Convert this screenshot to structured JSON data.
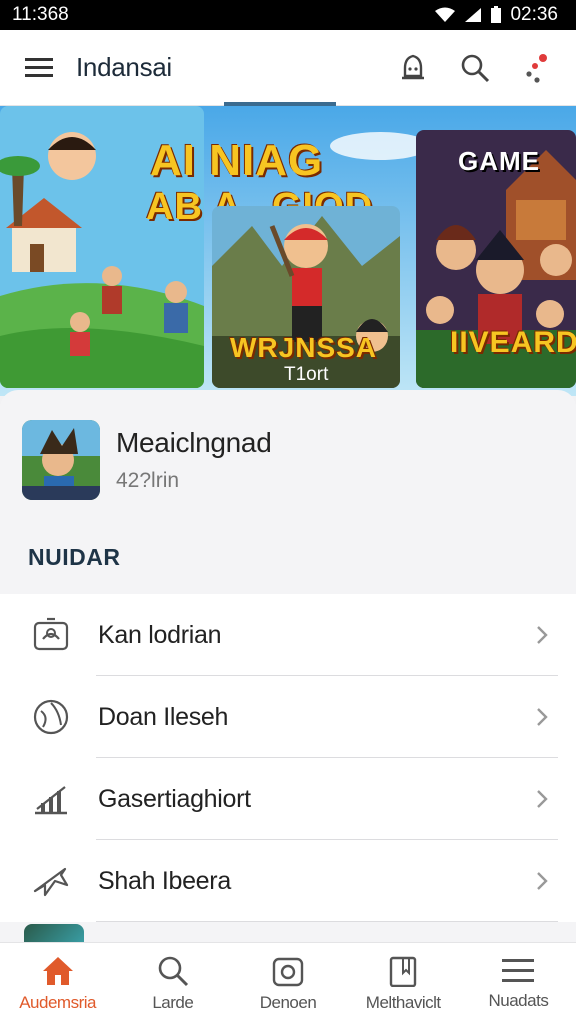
{
  "status": {
    "time": "11:368",
    "clock": "02:36"
  },
  "appbar": {
    "title": "Indansai"
  },
  "carousel": {
    "banner1": {
      "line1": "AI NIAG",
      "line2": "AB A",
      "line3": "GIOD"
    },
    "banner2": {
      "title": "WRJNSSA",
      "subtitle": "T1ort"
    },
    "banner3": {
      "title": "GAME",
      "subtitle": "IIVEARD"
    }
  },
  "featured": {
    "name": "Meaiclngnad",
    "sub": "42?lrin"
  },
  "section": {
    "heading": "NUIDAR"
  },
  "menu": [
    {
      "label": "Kan lodrian",
      "icon": "contacts-icon"
    },
    {
      "label": "Doan Ileseh",
      "icon": "globe-icon"
    },
    {
      "label": "Gasertiaghiort",
      "icon": "chart-icon"
    },
    {
      "label": "Shah Ibeera",
      "icon": "plane-icon"
    }
  ],
  "nav": [
    {
      "label": "Audemsria",
      "icon": "home-icon",
      "active": true
    },
    {
      "label": "Larde",
      "icon": "search-icon"
    },
    {
      "label": "Denoen",
      "icon": "camera-icon"
    },
    {
      "label": "Melthaviclt",
      "icon": "book-icon"
    },
    {
      "label": "Nuadats",
      "icon": "menu-icon"
    }
  ],
  "colors": {
    "accent": "#e05a2b",
    "primary": "#1d2b39",
    "sky": "#5fb3e0"
  }
}
